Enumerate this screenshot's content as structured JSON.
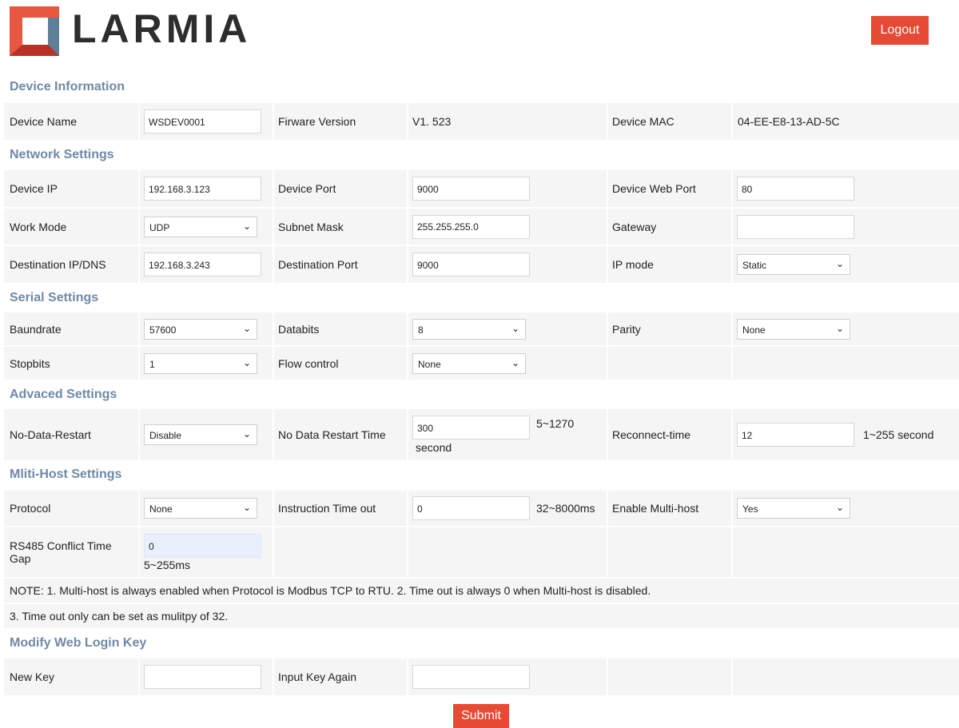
{
  "brand": {
    "name": "LARMIA"
  },
  "header": {
    "logout_label": "Logout"
  },
  "device_info": {
    "title": "Device Information",
    "device_name_label": "Device Name",
    "device_name_value": "WSDEV0001",
    "firmware_label": "Firware Version",
    "firmware_value": "V1. 523",
    "mac_label": "Device MAC",
    "mac_value": "04-EE-E8-13-AD-5C"
  },
  "network": {
    "title": "Network Settings",
    "device_ip_label": "Device IP",
    "device_ip_value": "192.168.3.123",
    "device_port_label": "Device Port",
    "device_port_value": "9000",
    "web_port_label": "Device Web Port",
    "web_port_value": "80",
    "work_mode_label": "Work Mode",
    "work_mode_value": "UDP",
    "subnet_label": "Subnet Mask",
    "subnet_value": "255.255.255.0",
    "gateway_label": "Gateway",
    "gateway_value": "",
    "dest_ip_label": "Destination IP/DNS",
    "dest_ip_value": "192.168.3.243",
    "dest_port_label": "Destination Port",
    "dest_port_value": "9000",
    "ip_mode_label": "IP mode",
    "ip_mode_value": "Static"
  },
  "serial": {
    "title": "Serial Settings",
    "baud_label": "Baundrate",
    "baud_value": "57600",
    "databits_label": "Databits",
    "databits_value": "8",
    "parity_label": "Parity",
    "parity_value": "None",
    "stopbits_label": "Stopbits",
    "stopbits_value": "1",
    "flow_label": "Flow control",
    "flow_value": "None"
  },
  "advanced": {
    "title": "Advaced Settings",
    "no_data_restart_label": "No-Data-Restart",
    "no_data_restart_value": "Disable",
    "restart_time_label": "No Data Restart Time",
    "restart_time_value": "300",
    "restart_time_range": "5~1270",
    "restart_time_unit": "second",
    "reconnect_label": "Reconnect-time",
    "reconnect_value": "12",
    "reconnect_unit": "1~255 second"
  },
  "multihost": {
    "title": "Mliti-Host Settings",
    "protocol_label": "Protocol",
    "protocol_value": "None",
    "timeout_label": "Instruction Time out",
    "timeout_value": "0",
    "timeout_unit": "32~8000ms",
    "enable_label": "Enable Multi-host",
    "enable_value": "Yes",
    "conflict_label": "RS485 Conflict Time Gap",
    "conflict_value": "0",
    "conflict_unit": "5~255ms",
    "note1": "NOTE: 1. Multi-host is always enabled when Protocol is Modbus TCP to RTU. 2. Time out is always 0 when Multi-host is disabled.",
    "note2": "3. Time out only can be set as mulitpy of 32."
  },
  "login_key": {
    "title": "Modify Web Login Key",
    "new_key_label": "New Key",
    "new_key_value": "",
    "again_label": "Input Key Again",
    "again_value": ""
  },
  "submit_label": "Submit",
  "colors": {
    "accent": "#e54a35",
    "section_title": "#6f8aa6",
    "row_bg": "#f5f5f5"
  },
  "icons": {
    "select_arrow": "chevron-down-icon"
  }
}
